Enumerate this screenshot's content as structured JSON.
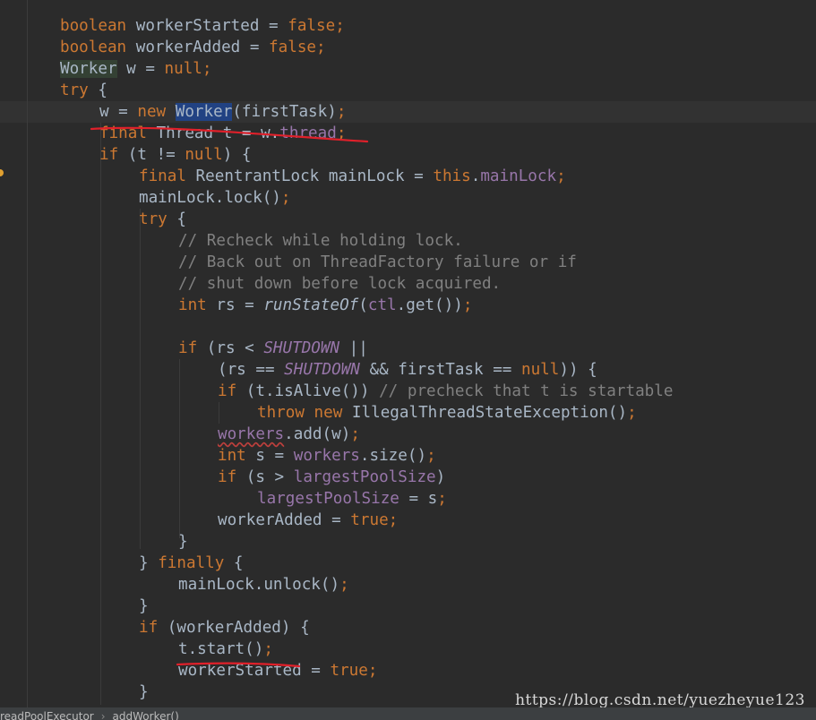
{
  "code": {
    "l1": {
      "t1": "boolean",
      "t2": " workerStarted = ",
      "t3": "false",
      "t4": ";"
    },
    "l2": {
      "t1": "boolean",
      "t2": " workerAdded = ",
      "t3": "false",
      "t4": ";"
    },
    "l3": {
      "t1": "Worker",
      "t2": " w = ",
      "t3": "null",
      "t4": ";"
    },
    "l4": {
      "t1": "try",
      "t2": " {"
    },
    "l5": {
      "t1": "w = ",
      "t2": "new",
      "t3": " ",
      "t4": "Worker",
      "t5": "(firstTask)",
      "t6": ";"
    },
    "l6": {
      "t1": "final",
      "t2": " Thread t = w.",
      "t3": "thread",
      "t4": ";"
    },
    "l7": {
      "t1": "if",
      "t2": " (t != ",
      "t3": "null",
      "t4": ") {"
    },
    "l8": {
      "t1": "final",
      "t2": " ReentrantLock mainLock = ",
      "t3": "this",
      "t4": ".",
      "t5": "mainLock",
      "t6": ";"
    },
    "l9": {
      "t1": "mainLock.lock()",
      "t2": ";"
    },
    "l10": {
      "t1": "try",
      "t2": " {"
    },
    "l11": {
      "t1": "// Recheck while holding lock."
    },
    "l12": {
      "t1": "// Back out on ThreadFactory failure or if"
    },
    "l13": {
      "t1": "// shut down before lock acquired."
    },
    "l14": {
      "t1": "int",
      "t2": " rs = ",
      "t3": "runStateOf",
      "t4": "(",
      "t5": "ctl",
      "t6": ".get())",
      "t7": ";"
    },
    "l16": {
      "t1": "if",
      "t2": " (rs < ",
      "t3": "SHUTDOWN",
      "t4": " ||"
    },
    "l17": {
      "t1": "(rs == ",
      "t2": "SHUTDOWN",
      "t3": " && firstTask == ",
      "t4": "null",
      "t5": ")) {"
    },
    "l18": {
      "t1": "if",
      "t2": " (t.isAlive()) ",
      "t3": "// precheck that t is startable"
    },
    "l19": {
      "t1": "throw new",
      "t2": " IllegalThreadStateException()",
      "t3": ";"
    },
    "l20": {
      "t1": "workers",
      "t2": ".add(w)",
      "t3": ";"
    },
    "l21": {
      "t1": "int",
      "t2": " s = ",
      "t3": "workers",
      "t4": ".size()",
      "t5": ";"
    },
    "l22": {
      "t1": "if",
      "t2": " (s > ",
      "t3": "largestPoolSize",
      "t4": ")"
    },
    "l23": {
      "t1": "largestPoolSize",
      "t2": " = s",
      "t3": ";"
    },
    "l24": {
      "t1": "workerAdded = ",
      "t2": "true",
      "t3": ";"
    },
    "l25": {
      "t1": "}"
    },
    "l26": {
      "t1": "} ",
      "t2": "finally",
      "t3": " {"
    },
    "l27": {
      "t1": "mainLock.unlock()",
      "t2": ";"
    },
    "l28": {
      "t1": "}"
    },
    "l29": {
      "t1": "if",
      "t2": " (workerAdded) {"
    },
    "l30": {
      "t1": "t.start()",
      "t2": ";"
    },
    "l31": {
      "t1": "workerStarted = ",
      "t2": "true",
      "t3": ";"
    },
    "l32": {
      "t1": "}"
    }
  },
  "watermark": "https://blog.csdn.net/yuezheyue123",
  "breadcrumb": {
    "class_name": "readPoolExecutor",
    "separator": "›",
    "method_name": "addWorker()"
  },
  "colors": {
    "background": "#2b2b2b",
    "keyword": "#cc7832",
    "field": "#9876aa",
    "comment": "#808080",
    "text": "#a9b7c6",
    "annotation": "#e0202a",
    "selection": "#214283"
  }
}
